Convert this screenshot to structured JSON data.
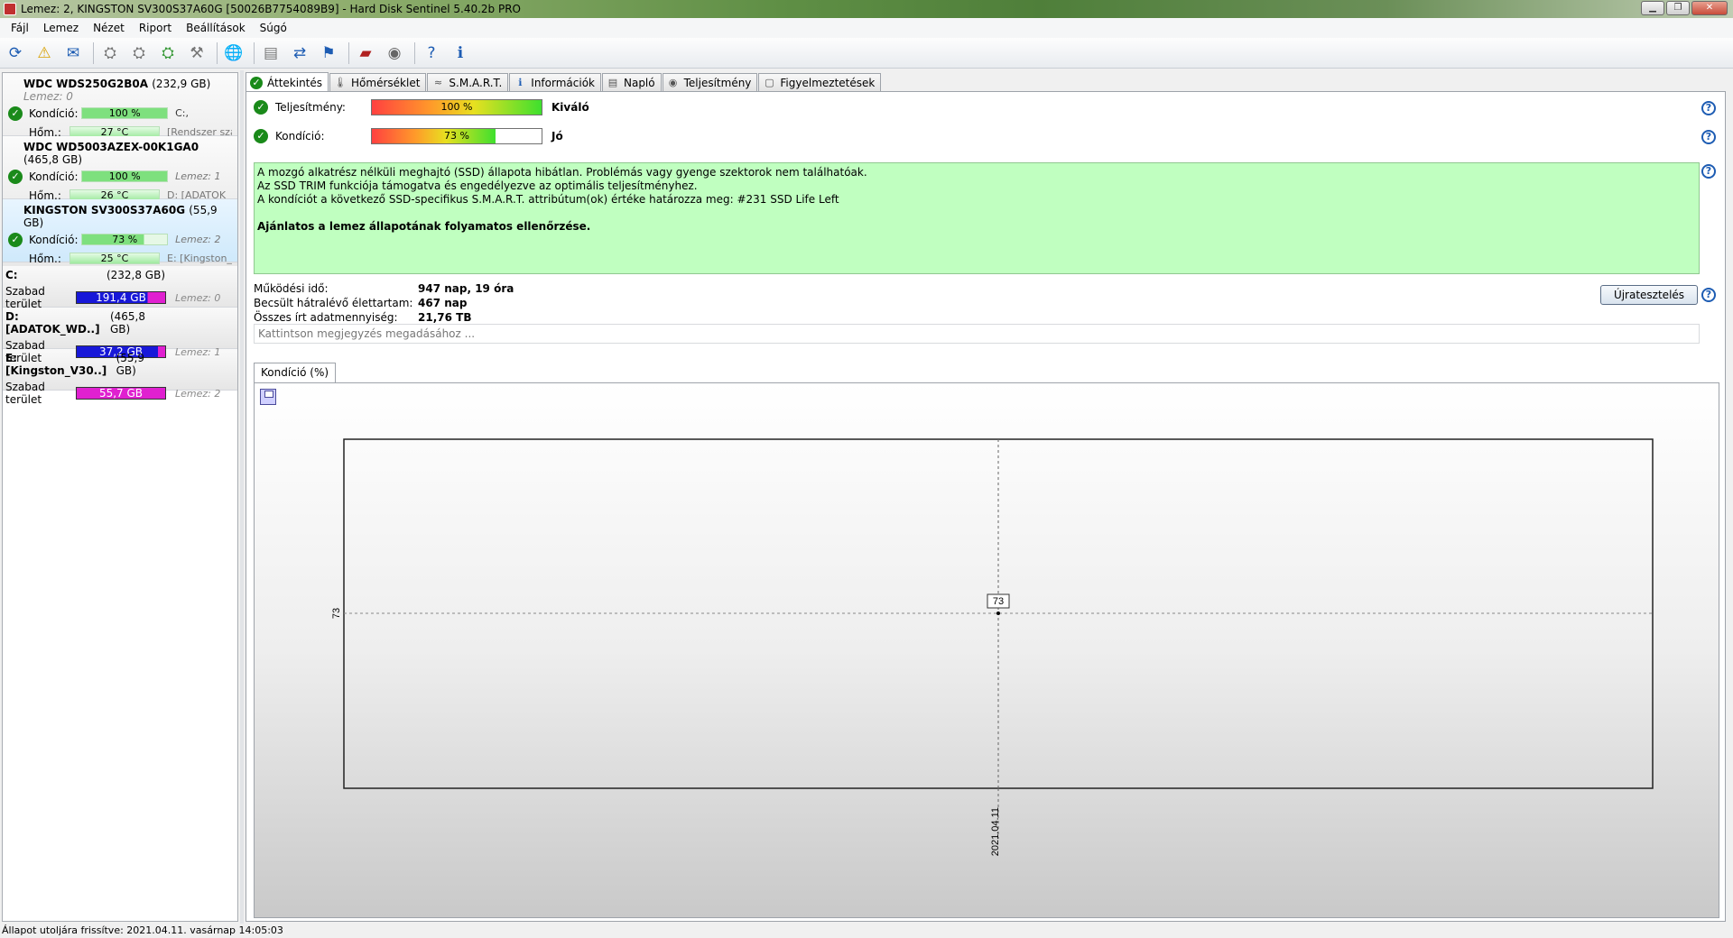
{
  "window": {
    "title": "Lemez: 2, KINGSTON SV300S37A60G [50026B7754089B9]  -  Hard Disk Sentinel 5.40.2b PRO"
  },
  "menu": [
    "Fájl",
    "Lemez",
    "Nézet",
    "Riport",
    "Beállítások",
    "Súgó"
  ],
  "disks": [
    {
      "name": "WDC WDS250G2B0A",
      "size": "(232,9 GB)",
      "lemez": "Lemez: 0",
      "health_label": "Kondíció:",
      "health": "100 %",
      "health_pct": 100,
      "temp_label": "Hőm.:",
      "temp": "27 °C",
      "info1": "C:,",
      "info2": "[Rendszer szá"
    },
    {
      "name": "WDC WD5003AZEX-00K1GA0",
      "size": "(465,8 GB)",
      "lemez": "",
      "health_label": "Kondíció:",
      "health": "100 %",
      "health_pct": 100,
      "temp_label": "Hőm.:",
      "temp": "26 °C",
      "info1": "Lemez: 1",
      "info2": "D: [ADATOK_"
    },
    {
      "name": "KINGSTON SV300S37A60G",
      "size": "(55,9 GB)",
      "lemez": "",
      "health_label": "Kondíció:",
      "health": "73 %",
      "health_pct": 73,
      "temp_label": "Hőm.:",
      "temp": "25 °C",
      "info1": "Lemez: 2",
      "info2": "E: [Kingston_V"
    }
  ],
  "volumes": [
    {
      "name": "C:",
      "size": "(232,8 GB)",
      "label": "Szabad terület",
      "free": "191,4 GB",
      "color": "#1818d8",
      "lemez": "Lemez: 0"
    },
    {
      "name": "D: [ADATOK_WD..]",
      "size": "(465,8 GB)",
      "label": "Szabad terület",
      "free": "37,2 GB",
      "color": "#1818d8",
      "lemez": "Lemez: 1"
    },
    {
      "name": "E: [Kingston_V30..]",
      "size": "(55,9 GB)",
      "label": "Szabad terület",
      "free": "55,7 GB",
      "color": "#e020d0",
      "lemez": "Lemez: 2"
    }
  ],
  "tabs": [
    "Áttekintés",
    "Hőmérséklet",
    "S.M.A.R.T.",
    "Információk",
    "Napló",
    "Teljesítmény",
    "Figyelmeztetések"
  ],
  "overview": {
    "performance_label": "Teljesítmény:",
    "performance_value": "100 %",
    "performance_pct": 100,
    "performance_result": "Kiváló",
    "health_label": "Kondíció:",
    "health_value": "73 %",
    "health_pct": 73,
    "health_result": "Jó",
    "info_lines": [
      "A mozgó alkatrész nélküli meghajtó (SSD) állapota hibátlan. Problémás vagy gyenge szektorok nem találhatóak.",
      "Az SSD TRIM funkciója támogatva és engedélyezve az optimális teljesítményhez.",
      "A kondíciót a következő SSD-specifikus S.M.A.R.T. attribútum(ok) értéke határozza meg:  #231 SSD Life Left"
    ],
    "recommendation": "Ajánlatos a lemez állapotának folyamatos ellenőrzése.",
    "uptime_label": "Működési idő:",
    "uptime": "947 nap, 19 óra",
    "remaining_label": "Becsült hátralévő élettartam:",
    "remaining": "467 nap",
    "written_label": "Összes írt adatmennyiség:",
    "written": "21,76 TB",
    "retest_button": "Újratesztelés",
    "note_placeholder": "Kattintson megjegyzés megadásához ..."
  },
  "chart_tab": "Kondíció  (%)",
  "chart_data": {
    "type": "line",
    "x": [
      "2021.04.11"
    ],
    "series": [
      {
        "values": [
          73
        ]
      }
    ],
    "data_labels": [
      "73"
    ],
    "y_ticks": [
      "73"
    ],
    "grid": true
  },
  "statusbar": "Állapot utoljára frissítve: 2021.04.11. vasárnap 14:05:03"
}
